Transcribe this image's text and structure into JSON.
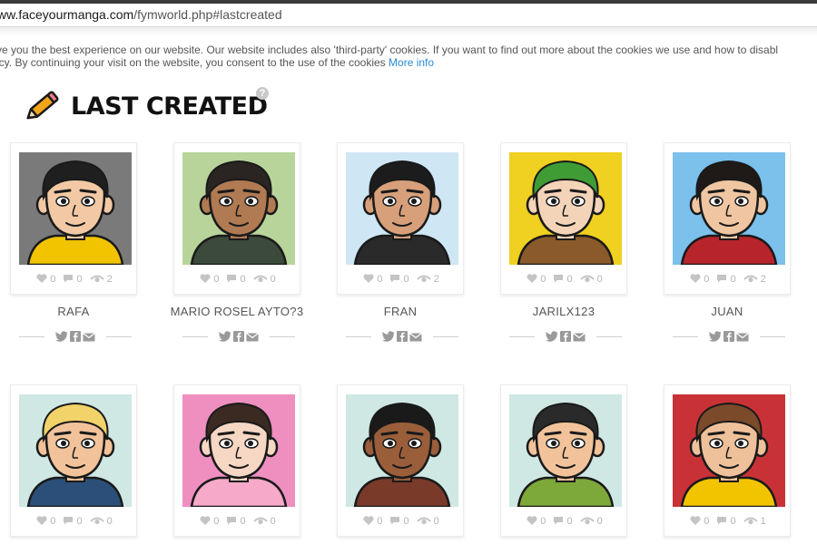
{
  "browser": {
    "url_host": "ww.faceyourmanga.com",
    "url_path": "/fymworld.php#lastcreated"
  },
  "cookie_notice": {
    "line1": "ve you the best experience on our website. Our website includes also 'third-party' cookies. If you want to find out more about the cookies we use and how to disabl",
    "line2": "icy. By continuing your visit on the website, you consent to the use of the cookies",
    "more_info": "More info"
  },
  "section": {
    "title": "LAST CREATED",
    "help": "?"
  },
  "colors": {
    "accent_link": "#2a8ad6",
    "stat_gray": "#b3b3b3",
    "title": "#111111"
  },
  "avatars": [
    {
      "name": "RAFA",
      "likes": "0",
      "comments": "0",
      "views": "2",
      "bg": "#7a7a7a",
      "skin": "#f2c9a4",
      "hair": "#1f1f1f",
      "shirt": "#f2c400"
    },
    {
      "name": "MARIO ROSEL AYTO?3",
      "likes": "0",
      "comments": "0",
      "views": "0",
      "bg": "#b8d49a",
      "skin": "#b07a52",
      "hair": "#2a2523",
      "shirt": "#3b4a3a"
    },
    {
      "name": "FRAN",
      "likes": "0",
      "comments": "0",
      "views": "2",
      "bg": "#cfe6f4",
      "skin": "#d7a07a",
      "hair": "#1c1c1c",
      "shirt": "#2a2a2a"
    },
    {
      "name": "JARILX123",
      "likes": "0",
      "comments": "0",
      "views": "0",
      "bg": "#f0d020",
      "skin": "#f4d4b8",
      "hair": "#3f9c35",
      "shirt": "#8a5a2a"
    },
    {
      "name": "JUAN",
      "likes": "0",
      "comments": "0",
      "views": "2",
      "bg": "#7cc0ec",
      "skin": "#f0c6a2",
      "hair": "#1f1a18",
      "shirt": "#b8242c"
    },
    {
      "name": "",
      "likes": "0",
      "comments": "0",
      "views": "0",
      "bg": "#cfe8e4",
      "skin": "#f2c39a",
      "hair": "#f2d36a",
      "shirt": "#2b4f78"
    },
    {
      "name": "",
      "likes": "0",
      "comments": "0",
      "views": "0",
      "bg": "#ee8fc0",
      "skin": "#f6d7c4",
      "hair": "#3a2a22",
      "shirt": "#f6a9c8"
    },
    {
      "name": "",
      "likes": "0",
      "comments": "0",
      "views": "0",
      "bg": "#cfe8e4",
      "skin": "#9a5e3a",
      "hair": "#1a1a1a",
      "shirt": "#7a3a2a"
    },
    {
      "name": "",
      "likes": "0",
      "comments": "0",
      "views": "0",
      "bg": "#cfe8e4",
      "skin": "#f2c39a",
      "hair": "#2a2a2a",
      "shirt": "#7da83a"
    },
    {
      "name": "",
      "likes": "0",
      "comments": "0",
      "views": "1",
      "bg": "#c83236",
      "skin": "#efc19a",
      "hair": "#7a4a2a",
      "shirt": "#f2c400"
    }
  ]
}
